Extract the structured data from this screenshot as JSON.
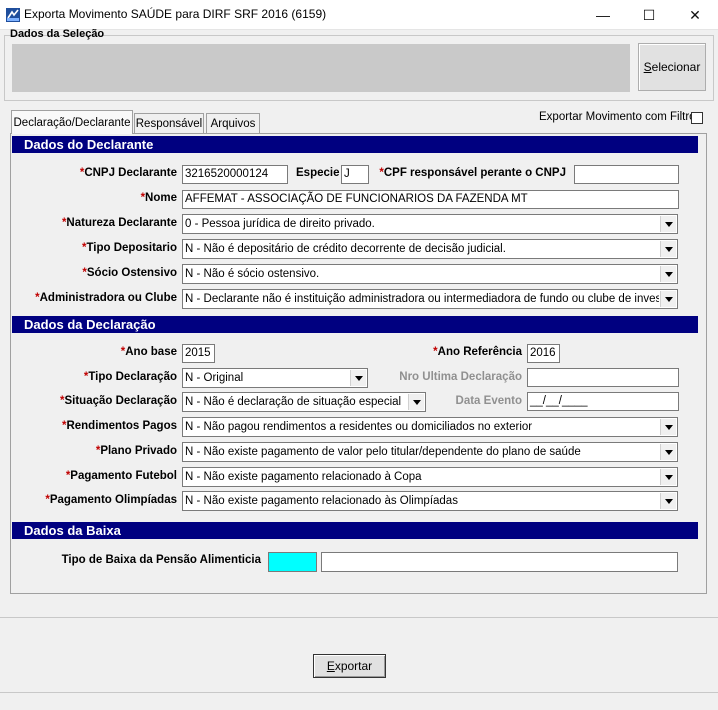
{
  "window": {
    "title": "Exporta Movimento SAÚDE para DIRF SRF 2016 (6159)",
    "minimize_glyph": "—",
    "maximize_glyph": "☐",
    "close_glyph": "✕"
  },
  "selection": {
    "group_title": "Dados da Seleção",
    "button_label": "Selecionar"
  },
  "tabs": [
    {
      "label": "Declaração/Declarante",
      "active": true
    },
    {
      "label": "Responsável",
      "active": false
    },
    {
      "label": "Arquivos",
      "active": false
    }
  ],
  "export_filter": {
    "label": "Exportar Movimento com Filtro",
    "checked": false
  },
  "declarante": {
    "section_title": "Dados do Declarante",
    "cnpj_label": "CNPJ Declarante",
    "cnpj_value": "32165200001​24",
    "especie_label": "Especie",
    "especie_value": "J",
    "cpf_label": "CPF responsável perante o CNPJ",
    "cpf_value": "",
    "nome_label": "Nome",
    "nome_value": "AFFEMAT - ASSOCIAÇÃO DE FUNCIONARIOS DA FAZENDA MT",
    "natureza_label": "Natureza Declarante",
    "natureza_value": "0 - Pessoa jurídica de direito privado.",
    "tipo_depositario_label": "Tipo Depositario",
    "tipo_depositario_value": "N - Não é depositário de crédito decorrente de decisão judicial.",
    "socio_label": "Sócio Ostensivo",
    "socio_value": "N - Não é sócio ostensivo.",
    "administradora_label": "Administradora ou Clube",
    "administradora_value": "N - Declarante não é instituição administradora ou intermediadora de fundo ou clube de investiment"
  },
  "declaracao": {
    "section_title": "Dados da Declaração",
    "ano_base_label": "Ano base",
    "ano_base_value": "2015",
    "ano_ref_label": "Ano Referência",
    "ano_ref_value": "2016",
    "tipo_label": "Tipo Declaração",
    "tipo_value": "N - Original",
    "nro_ultima_label": "Nro Ultima Declaração",
    "nro_ultima_value": "",
    "situacao_label": "Situação Declaração",
    "situacao_value": "N - Não é declaração de situação especial",
    "data_evento_label": "Data Evento",
    "data_evento_value": "__/__/____",
    "rendimentos_label": "Rendimentos Pagos",
    "rendimentos_value": "N - Não pagou rendimentos a residentes ou domiciliados no exterior",
    "plano_label": "Plano Privado",
    "plano_value": "N - Não existe pagamento de valor pelo titular/dependente do plano de saúde",
    "futebol_label": "Pagamento Futebol",
    "futebol_value": "N - Não existe pagamento relacionado à Copa",
    "olimpiadas_label": "Pagamento Olimpíadas",
    "olimpiadas_value": "N - Não existe pagamento relacionado às Olimpíadas"
  },
  "baixa": {
    "section_title": "Dados da Baixa",
    "tipo_label": "Tipo de Baixa da Pensão Alimenticia",
    "code_value": "",
    "desc_value": ""
  },
  "footer": {
    "export_label": "Exportar"
  },
  "required_marker": "*",
  "colors": {
    "section_bg": "#000080",
    "required": "#c00000",
    "code_field": "#00ffff"
  }
}
